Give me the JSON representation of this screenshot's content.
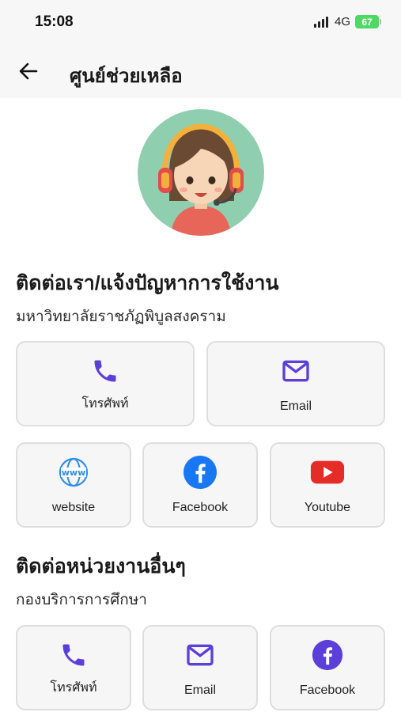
{
  "status_bar": {
    "time": "15:08",
    "network": "4G",
    "battery": "67"
  },
  "header": {
    "title": "ศูนย์ช่วยเหลือ",
    "back_icon": "arrow-left-icon"
  },
  "avatar": {
    "icon": "support-agent-avatar"
  },
  "section1": {
    "title": "ติดต่อเรา/แจ้งปัญหาการใช้งาน",
    "subtitle": "มหาวิทยาลัยราชภัฏพิบูลสงคราม",
    "cards": [
      {
        "label": "โทรศัพท์",
        "icon": "phone-icon"
      },
      {
        "label": "Email",
        "icon": "mail-icon"
      },
      {
        "label": "website",
        "icon": "www-globe-icon"
      },
      {
        "label": "Facebook",
        "icon": "facebook-icon"
      },
      {
        "label": "Youtube",
        "icon": "youtube-icon"
      }
    ]
  },
  "section2": {
    "title": "ติดต่อหน่วยงานอื่นๆ",
    "subtitle": "กองบริการการศึกษา",
    "cards": [
      {
        "label": "โทรศัพท์",
        "icon": "phone-icon"
      },
      {
        "label": "Email",
        "icon": "mail-icon"
      },
      {
        "label": "Facebook",
        "icon": "facebook-icon"
      }
    ]
  },
  "colors": {
    "accent": "#5b3fd9",
    "facebook": "#1877f2",
    "youtube": "#e52d27",
    "avatar_bg": "#8fcfb0"
  }
}
